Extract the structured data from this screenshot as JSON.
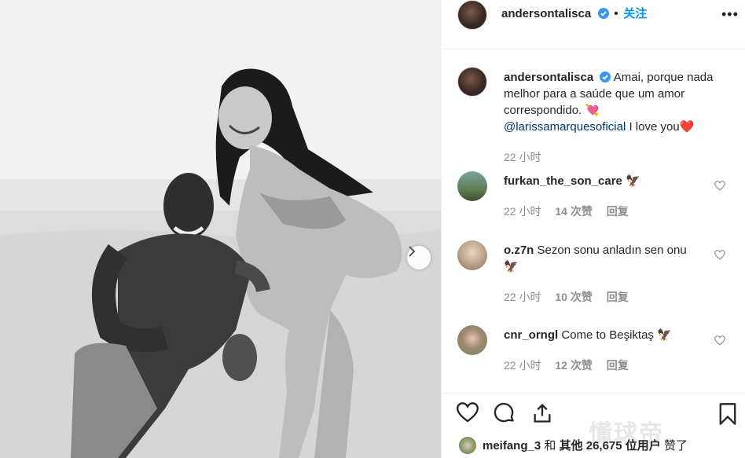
{
  "post": {
    "author": "andersontalisca",
    "follow_label": "关注",
    "more_label": "•••"
  },
  "caption": {
    "username": "andersontalisca",
    "text": "Amai, porque nada melhor para a saúde que um amor correspondido.",
    "emoji1": "💘",
    "mention": "@larissamarquesoficial",
    "text2": "I love you",
    "emoji2": "❤️",
    "time": "22 小时"
  },
  "comments": [
    {
      "username": "furkan_the_son_care",
      "text": "",
      "emoji": "🦅",
      "time": "22 小时",
      "likes": "14 次赞",
      "reply": "回复"
    },
    {
      "username": "o.z7n",
      "text": "Sezon sonu anladın sen onu",
      "emoji": "🦅",
      "time": "22 小时",
      "likes": "10 次赞",
      "reply": "回复"
    },
    {
      "username": "cnr_orngl",
      "text": "Come to Beşiktaş",
      "emoji": "🦅",
      "time": "22 小时",
      "likes": "12 次赞",
      "reply": "回复"
    }
  ],
  "likes_bar": {
    "user": "meifang_3",
    "and": "和",
    "others": "其他 26,675 位用户",
    "liked": "赞了"
  },
  "watermark": "懂球帝",
  "icons": [
    "verified-badge-icon",
    "more-options-icon",
    "heart-icon",
    "comment-icon",
    "share-icon",
    "bookmark-icon",
    "chevron-right-icon"
  ],
  "colors": {
    "follow": "#0095f6",
    "mention": "#00376b",
    "meta": "#8e8e8e",
    "verified": "#3897f0"
  }
}
